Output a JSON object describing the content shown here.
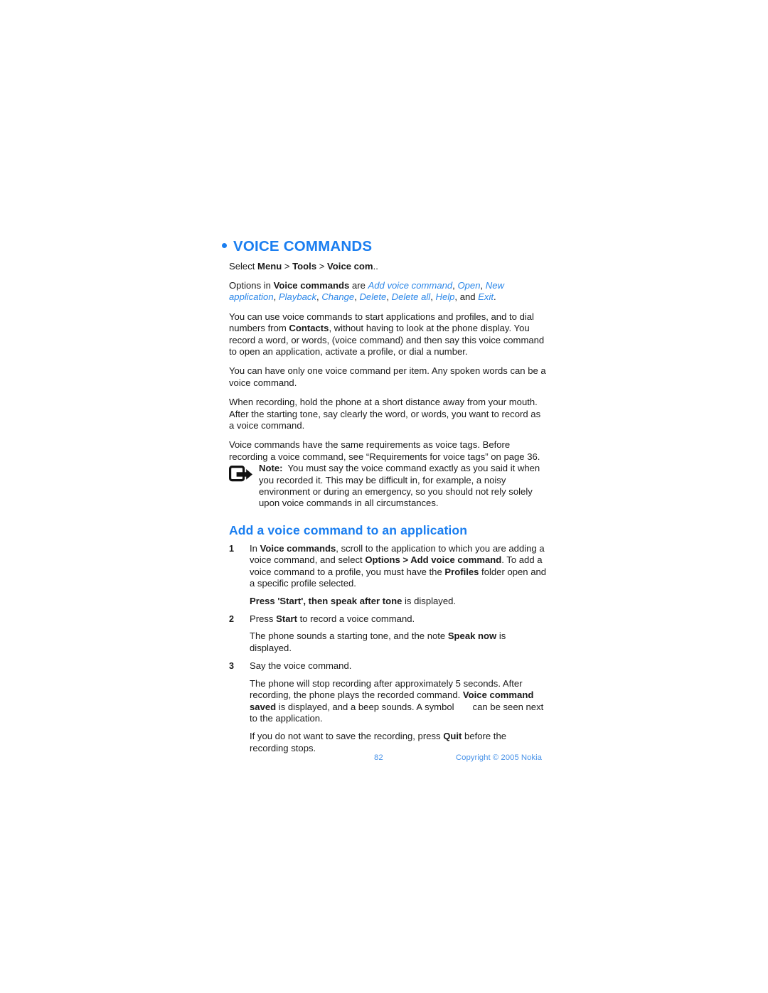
{
  "chapter": {
    "bullet_icon": "bullet-dot-icon",
    "title": "VOICE COMMANDS"
  },
  "select_path": {
    "prefix": "Select ",
    "menu": "Menu",
    "sep1": " > ",
    "tools": "Tools",
    "sep2": " > ",
    "voice_com": "Voice com",
    "suffix": ".."
  },
  "options_para": {
    "lead": "Options in ",
    "app": "Voice commands",
    "are": " are ",
    "options": [
      "Add voice command",
      "Open",
      "New application",
      "Playback",
      "Change",
      "Delete",
      "Delete all",
      "Help",
      "Exit"
    ],
    "and": "and ",
    "period": "."
  },
  "paragraphs": {
    "p1_a": "You can use voice commands to start applications and profiles, and to dial numbers from ",
    "p1_b": "Contacts",
    "p1_c": ", without having to look at the phone display. You record a word, or words, (voice command) and then say this voice command to open an application, activate a profile, or dial a number.",
    "p2": "You can have only one voice command per item. Any spoken words can be a voice command.",
    "p3": "When recording, hold the phone at a short distance away from your mouth. After the starting tone, say clearly the word, or words, you want to record as a voice command.",
    "p4": "Voice commands have the same requirements as voice tags. Before recording a voice command, see “Requirements for voice tags” on page 36."
  },
  "note": {
    "icon": "note-arrow-icon",
    "label": "Note:",
    "text": "You must say the voice command exactly as you said it when you recorded it. This may be difficult in, for example, a noisy environment or during an emergency, so you should not rely solely upon voice commands in all circumstances."
  },
  "section": {
    "title": "Add a voice command to an application"
  },
  "steps": [
    {
      "num": "1",
      "a": "In ",
      "b1": "Voice commands",
      "c": ", scroll to the application to which you are adding a voice command, and select ",
      "b2": "Options > Add voice command",
      "d": ". To add a voice command to a profile, you must have the ",
      "b3": "Profiles",
      "e": " folder open and a specific profile selected."
    },
    {
      "num": "2",
      "a": "Press ",
      "b1": "Start",
      "c": " to record a voice command."
    },
    {
      "num": "3",
      "a": "Say the voice command."
    }
  ],
  "sub_paragraphs": {
    "after_step1_b": "Press 'Start', then speak after tone",
    "after_step1_rest": " is displayed.",
    "after_step2_a": "The phone sounds a starting tone, and the note ",
    "after_step2_b": "Speak now",
    "after_step2_c": " is displayed.",
    "after_step3_a": "The phone will stop recording after approximately 5 seconds. After recording, the phone plays the recorded command. ",
    "after_step3_b": "Voice command saved",
    "after_step3_c": " is displayed, and a beep sounds. A symbol",
    "after_step3_d": "can be seen next to the application.",
    "final_a": "If you do not want to save the recording, press ",
    "final_b": "Quit",
    "final_c": " before the recording stops."
  },
  "footer": {
    "page_number": "82",
    "copyright": "Copyright © 2005 Nokia"
  },
  "colors": {
    "accent_blue": "#1a7ef0",
    "option_blue": "#2a86e8",
    "footer_blue": "#4a93e8",
    "body_text": "#1a1a1a",
    "page_bg": "#ffffff"
  }
}
